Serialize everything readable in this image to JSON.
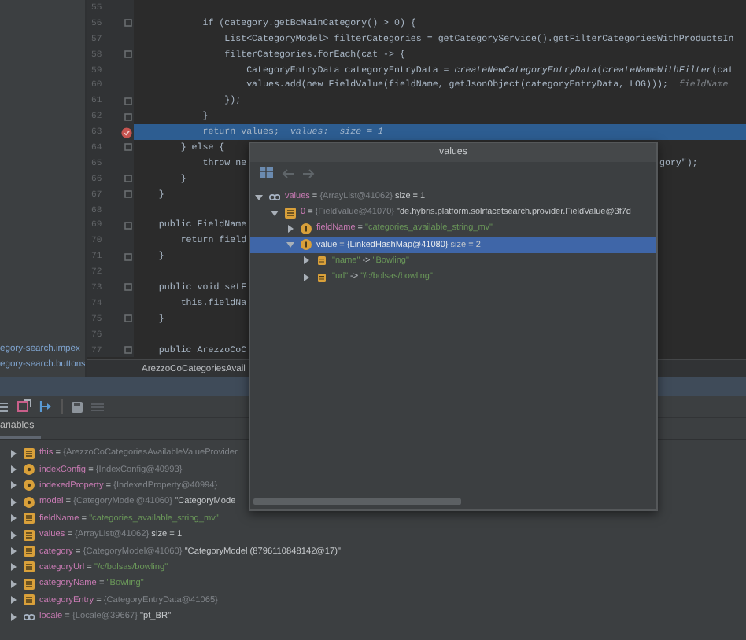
{
  "project": {
    "items": [
      {
        "label": "egory-search.impex"
      },
      {
        "label": "egory-search.buttons"
      }
    ]
  },
  "editor": {
    "lines": [
      {
        "number": "55",
        "current": false
      },
      {
        "number": "56",
        "text": "            if (category.getBcMainCategory() > 0) {",
        "kind": "fold",
        "current": false
      },
      {
        "number": "57",
        "text": "                List<CategoryModel> filterCategories = getCategoryService().getFilterCategoriesWithProductsIn",
        "current": false
      },
      {
        "number": "58",
        "text": "                filterCategories.forEach(cat -> {",
        "kind": "fold",
        "current": false
      },
      {
        "number": "59",
        "text": "                    CategoryEntryData categoryEntryData = *createNewCategoryEntryData*(*createNameWithFilter*(cat",
        "current": false
      },
      {
        "number": "60",
        "text": "                    values.add(new FieldValue(fieldName, getJsonObject(categoryEntryData, LOG)));",
        "hint": "fieldName",
        "current": false
      },
      {
        "number": "61",
        "text": "                });",
        "kind": "fold",
        "current": false
      },
      {
        "number": "62",
        "text": "            }",
        "kind": "fold",
        "current": false
      },
      {
        "number": "63",
        "text": "            return values;",
        "hint": "values:  size = 1",
        "kind": "breakpoint",
        "current": true
      },
      {
        "number": "64",
        "text": "        } else {",
        "kind": "fold",
        "current": false
      },
      {
        "number": "65",
        "text": "            throw ne",
        "right": "gory\");",
        "current": false
      },
      {
        "number": "66",
        "text": "        }",
        "kind": "fold",
        "current": false
      },
      {
        "number": "67",
        "text": "    }",
        "kind": "fold",
        "current": false
      },
      {
        "number": "68",
        "current": false
      },
      {
        "number": "69",
        "text": "    public FieldName",
        "kind": "fold",
        "current": false
      },
      {
        "number": "70",
        "text": "        return field",
        "current": false
      },
      {
        "number": "71",
        "text": "    }",
        "kind": "fold",
        "current": false
      },
      {
        "number": "72",
        "current": false
      },
      {
        "number": "73",
        "text": "    public void setF",
        "kind": "fold",
        "current": false
      },
      {
        "number": "74",
        "text": "        this.fieldNa",
        "current": false
      },
      {
        "number": "75",
        "text": "    }",
        "kind": "fold",
        "current": false
      },
      {
        "number": "76",
        "current": false
      },
      {
        "number": "77",
        "text": "    public ArezzoCoC",
        "kind": "fold",
        "current": false
      }
    ],
    "breadcrumb": "ArezzoCoCategoriesAvail"
  },
  "debugger": {
    "tab": "ariables",
    "variables": [
      {
        "kind": "local",
        "name": "this",
        "sep": "=",
        "ref": "{ArezzoCoCategoriesAvailableValueProvider",
        "expanded": false
      },
      {
        "kind": "param",
        "name": "indexConfig",
        "sep": "=",
        "ref": "{IndexConfig@40993}",
        "expanded": false
      },
      {
        "kind": "param",
        "name": "indexedProperty",
        "sep": "=",
        "ref": "{IndexedProperty@40994}",
        "expanded": false
      },
      {
        "kind": "param",
        "name": "model",
        "sep": "=",
        "ref": "{CategoryModel@41060}",
        "value": "\"CategoryMode",
        "string": false,
        "expanded": false
      },
      {
        "kind": "local",
        "name": "fieldName",
        "sep": "=",
        "value": "\"categories_available_string_mv\"",
        "string": true,
        "expanded": false
      },
      {
        "kind": "local",
        "name": "values",
        "sep": "=",
        "ref": "{ArrayList@41062}",
        "value": "size = 1",
        "string": false,
        "expanded": false
      },
      {
        "kind": "local",
        "name": "category",
        "sep": "=",
        "ref": "{CategoryModel@41060}",
        "value": "\"CategoryModel (8796110848142@17)\"",
        "string": false,
        "expanded": false
      },
      {
        "kind": "local",
        "name": "categoryUrl",
        "sep": "=",
        "value": "\"/c/bolsas/bowling\"",
        "string": true,
        "expanded": false
      },
      {
        "kind": "local",
        "name": "categoryName",
        "sep": "=",
        "value": "\"Bowling\"",
        "string": true,
        "expanded": false
      },
      {
        "kind": "local",
        "name": "categoryEntry",
        "sep": "=",
        "ref": "{CategoryEntryData@41065}",
        "expanded": false
      },
      {
        "kind": "inline",
        "name": "locale",
        "sep": "=",
        "ref": "{Locale@39667}",
        "value": "\"pt_BR\"",
        "string": false,
        "expanded": false
      }
    ]
  },
  "popup": {
    "title": "values",
    "tree": [
      {
        "kind": "inline",
        "name": "values",
        "sep": "=",
        "ref": "{ArrayList@41062}",
        "value": "size = 1",
        "string": false,
        "expanded": true,
        "selected": false,
        "children": [
          {
            "kind": "local",
            "name": "0",
            "sep": "=",
            "ref": "{FieldValue@41070}",
            "value": "\"de.hybris.platform.solrfacetsearch.provider.FieldValue@3f7d",
            "string": false,
            "expanded": true,
            "selected": false,
            "children": [
              {
                "kind": "field",
                "name": "fieldName",
                "sep": "=",
                "value": "\"categories_available_string_mv\"",
                "string": true,
                "expanded": false,
                "selected": false
              },
              {
                "kind": "field",
                "name": "value",
                "sep": "=",
                "ref": "{LinkedHashMap@41080}",
                "value": "size = 2",
                "string": false,
                "expanded": true,
                "selected": true,
                "children": [
                  {
                    "kind": "entry",
                    "name": "\"name\"",
                    "sep": "->",
                    "value": "\"Bowling\"",
                    "string": true,
                    "expanded": false,
                    "selected": false
                  },
                  {
                    "kind": "entry",
                    "name": "\"url\"",
                    "sep": "->",
                    "value": "\"/c/bolsas/bowling\"",
                    "string": true,
                    "expanded": false,
                    "selected": false
                  }
                ]
              }
            ]
          }
        ]
      }
    ]
  }
}
